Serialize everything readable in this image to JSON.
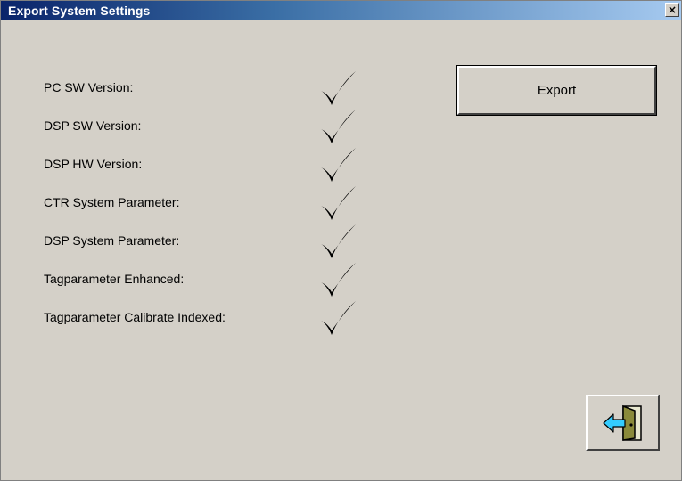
{
  "window": {
    "title": "Export System Settings",
    "close_label": "×"
  },
  "items": [
    {
      "label": "PC SW Version:",
      "checked": true
    },
    {
      "label": "DSP SW Version:",
      "checked": true
    },
    {
      "label": "DSP HW Version:",
      "checked": true
    },
    {
      "label": "CTR System Parameter:",
      "checked": true
    },
    {
      "label": "DSP System Parameter:",
      "checked": true
    },
    {
      "label": "Tagparameter Enhanced:",
      "checked": true
    },
    {
      "label": "Tagparameter Calibrate Indexed:",
      "checked": true
    }
  ],
  "buttons": {
    "export_label": "Export",
    "exit_icon": "exit-door-icon"
  },
  "colors": {
    "titlebar_start": "#0a246a",
    "titlebar_end": "#a6caf0",
    "dialog_bg": "#d4d0c8",
    "arrow": "#33ccff",
    "door": "#8a8a3a"
  }
}
